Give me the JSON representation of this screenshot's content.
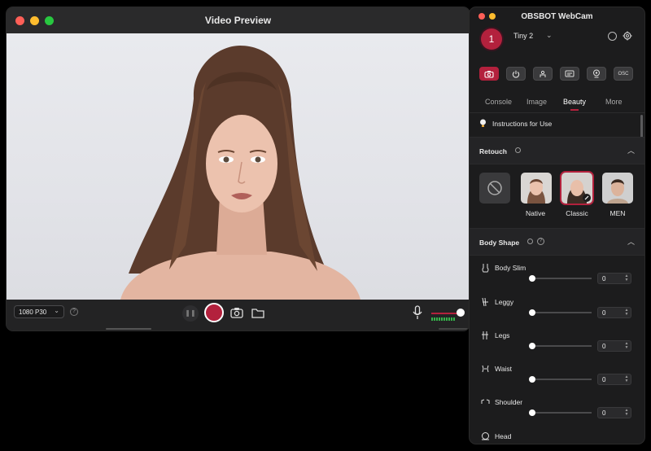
{
  "preview_window": {
    "title": "Video Preview",
    "resolution": "1080 P30",
    "help_icon": "?"
  },
  "panel": {
    "title": "OBSBOT WebCam",
    "device_number": "1",
    "device_name": "Tiny 2",
    "mode_buttons": [
      {
        "icon": "camera-icon",
        "active": true
      },
      {
        "icon": "power-icon",
        "active": false
      },
      {
        "icon": "tracking-icon",
        "active": false
      },
      {
        "icon": "subtitle-icon",
        "active": false
      },
      {
        "icon": "webcam-icon",
        "active": false
      },
      {
        "label": "OSC",
        "active": false
      }
    ],
    "tabs": [
      "Console",
      "Image",
      "Beauty",
      "More"
    ],
    "active_tab": "Beauty",
    "instructions": "Instructions for Use",
    "retouch": {
      "title": "Retouch",
      "options": [
        "",
        "Native",
        "Classic",
        "MEN"
      ],
      "selected": "Classic"
    },
    "body_shape": {
      "title": "Body Shape",
      "items": [
        {
          "label": "Body Slim",
          "value": "0"
        },
        {
          "label": "Leggy",
          "value": "0"
        },
        {
          "label": "Legs",
          "value": "0"
        },
        {
          "label": "Waist",
          "value": "0"
        },
        {
          "label": "Shoulder",
          "value": "0"
        },
        {
          "label": "Head",
          "value": ""
        }
      ]
    }
  },
  "colors": {
    "accent": "#b3213d",
    "panel_bg": "#1c1c1d",
    "window_bg": "#1e1e1f"
  }
}
